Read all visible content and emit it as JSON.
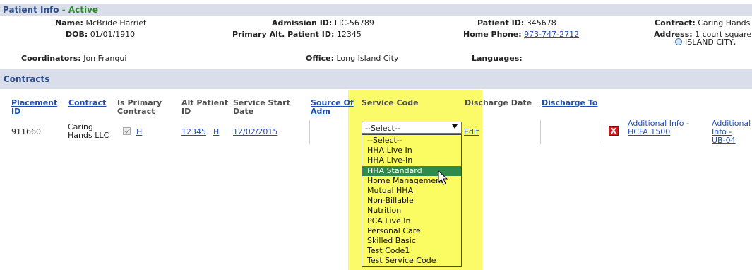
{
  "patient_info": {
    "title": "Patient Info",
    "status": "- Active",
    "name_label": "Name:",
    "name_value": "McBride Harriet",
    "admission_label": "Admission ID:",
    "admission_value": "LIC-56789",
    "patient_id_label": "Patient ID:",
    "patient_id_value": "345678",
    "contract_label": "Contract:",
    "contract_value": "Caring Hands",
    "dob_label": "DOB:",
    "dob_value": "01/01/1910",
    "primary_alt_label": "Primary Alt. Patient ID:",
    "primary_alt_value": "12345",
    "home_phone_label": "Home Phone:",
    "home_phone_value": "973-747-2712",
    "address_label": "Address:",
    "address_line1": "1 court square",
    "address_line2": "ISLAND CITY,",
    "coordinators_label": "Coordinators:",
    "coordinators_value": "Jon Franqui",
    "office_label": "Office:",
    "office_value": "Long Island City",
    "languages_label": "Languages:"
  },
  "contracts": {
    "title": "Contracts",
    "headers": {
      "placement_id": [
        "Placement",
        "ID"
      ],
      "contract": "Contract",
      "is_primary": [
        "Is Primary",
        "Contract"
      ],
      "alt_patient": [
        "Alt Patient",
        "ID"
      ],
      "service_start": [
        "Service Start",
        "Date"
      ],
      "source_of": [
        "Source Of",
        "Adm"
      ],
      "service_code": "Service Code",
      "discharge_date": "Discharge Date",
      "discharge_to": "Discharge To"
    },
    "row": {
      "placement_id": "911660",
      "contract_line1": "Caring",
      "contract_line2": "Hands LLC",
      "primary_h": "H",
      "alt_id": "12345",
      "alt_h": "H",
      "start_date": "12/02/2015",
      "edit_label": "Edit",
      "delete_icon": "X",
      "additional_info_1": [
        "Additional Info -",
        "HCFA 1500"
      ],
      "additional_info_2": [
        "Additional",
        "Info -",
        "UB-04"
      ]
    },
    "service_code_select": {
      "selected": "--Select--",
      "highlighted": "HHA Standard",
      "options": [
        "--Select--",
        "HHA Live In",
        "HHA Live-In",
        "HHA Standard",
        "Home Management",
        "Mutual HHA",
        "Non-Billable",
        "Nutrition",
        "PCA Live In",
        "Personal Care",
        "Skilled Basic",
        "Test Code1",
        "Test Service Code"
      ]
    }
  },
  "colors": {
    "header_bar": "#d9deea",
    "title_blue": "#2d4f8a",
    "active_green": "#2e8b2e",
    "highlight_yellow": "#fbfb62",
    "option_selected": "#2e8b4c",
    "link_blue": "#1f4fb4",
    "delete_red": "#cc1f1f"
  }
}
